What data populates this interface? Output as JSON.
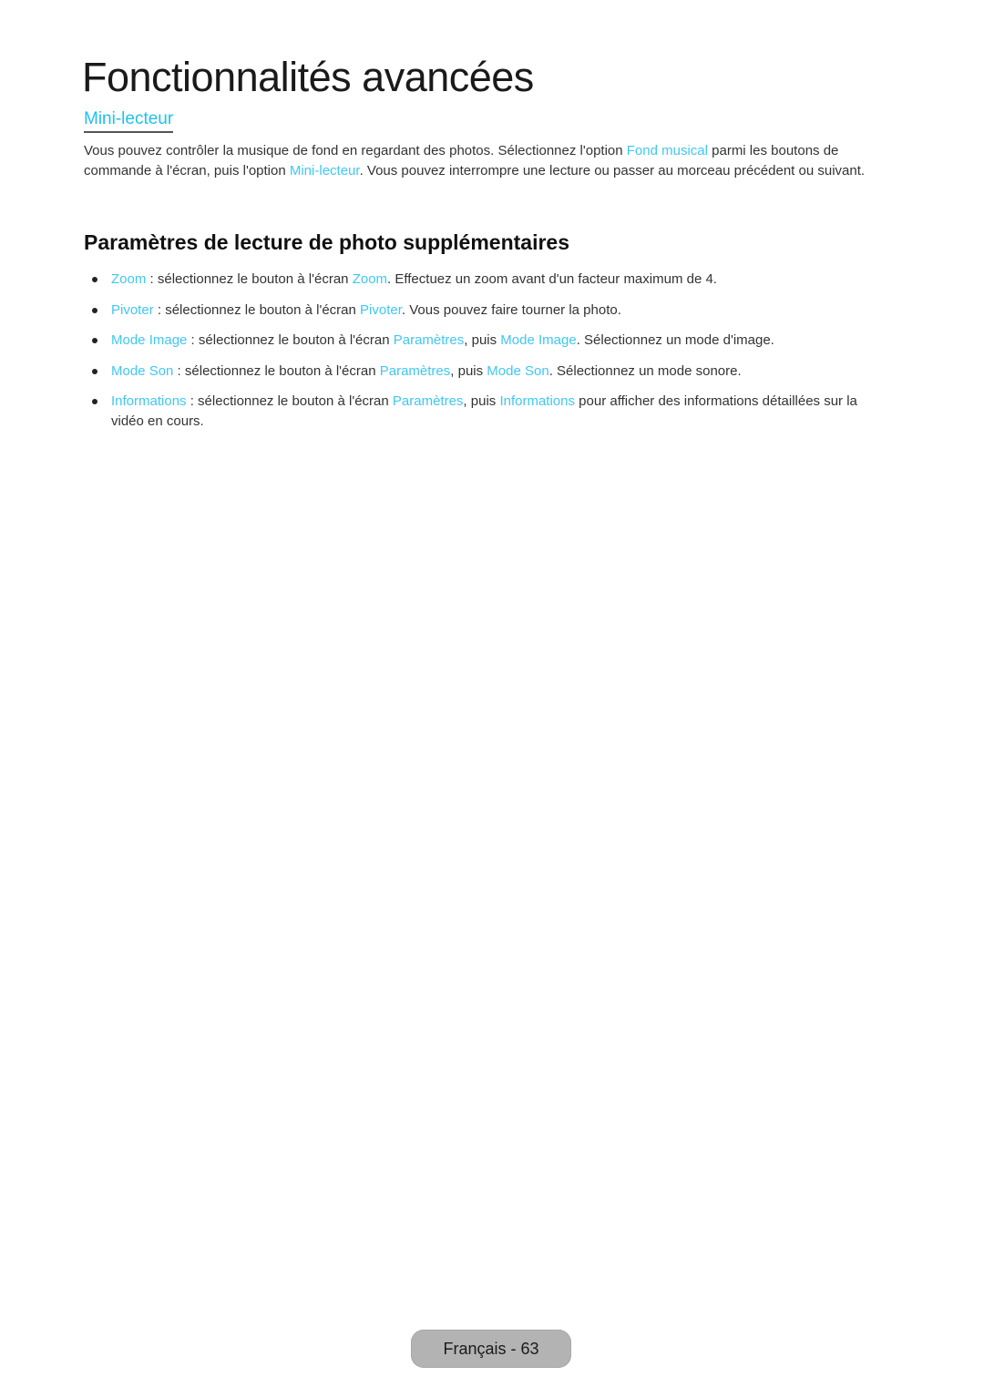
{
  "page": {
    "title": "Fonctionnalités avancées",
    "subheading": "Mini-lecteur",
    "intro": [
      {
        "text": "Vous pouvez contrôler la musique de fond en regardant des photos. Sélectionnez l'option ",
        "hl": false
      },
      {
        "text": "Fond musical",
        "hl": true
      },
      {
        "text": " parmi les boutons de commande à l'écran, puis l'option ",
        "hl": false
      },
      {
        "text": "Mini-lecteur",
        "hl": true
      },
      {
        "text": ". Vous pouvez interrompre une lecture ou passer au morceau précédent ou suivant.",
        "hl": false
      }
    ],
    "section_heading": "Paramètres de lecture de photo supplémentaires",
    "bullets": [
      [
        {
          "text": "Zoom",
          "hl": true
        },
        {
          "text": " : sélectionnez le bouton à l'écran ",
          "hl": false
        },
        {
          "text": "Zoom",
          "hl": true
        },
        {
          "text": ". Effectuez un zoom avant d'un facteur maximum de 4.",
          "hl": false
        }
      ],
      [
        {
          "text": "Pivoter",
          "hl": true
        },
        {
          "text": " : sélectionnez le bouton à l'écran ",
          "hl": false
        },
        {
          "text": "Pivoter",
          "hl": true
        },
        {
          "text": ". Vous pouvez faire tourner la photo.",
          "hl": false
        }
      ],
      [
        {
          "text": "Mode Image",
          "hl": true
        },
        {
          "text": " : sélectionnez le bouton à l'écran ",
          "hl": false
        },
        {
          "text": "Paramètres",
          "hl": true
        },
        {
          "text": ", puis ",
          "hl": false
        },
        {
          "text": "Mode Image",
          "hl": true
        },
        {
          "text": ". Sélectionnez un mode d'image.",
          "hl": false
        }
      ],
      [
        {
          "text": "Mode Son",
          "hl": true
        },
        {
          "text": " : sélectionnez le bouton à l'écran ",
          "hl": false
        },
        {
          "text": "Paramètres",
          "hl": true
        },
        {
          "text": ", puis ",
          "hl": false
        },
        {
          "text": "Mode Son",
          "hl": true
        },
        {
          "text": ". Sélectionnez un mode sonore.",
          "hl": false
        }
      ],
      [
        {
          "text": "Informations",
          "hl": true
        },
        {
          "text": " : sélectionnez le bouton à l'écran ",
          "hl": false
        },
        {
          "text": "Paramètres",
          "hl": true
        },
        {
          "text": ", puis ",
          "hl": false
        },
        {
          "text": "Informations",
          "hl": true
        },
        {
          "text": " pour afficher des informations détaillées sur la vidéo en cours.",
          "hl": false
        }
      ]
    ],
    "footer": "Français - 63"
  },
  "colors": {
    "highlight": "#3fc8f0",
    "subheading": "#1ec0f0",
    "footer_bg": "#b3b3b3"
  }
}
